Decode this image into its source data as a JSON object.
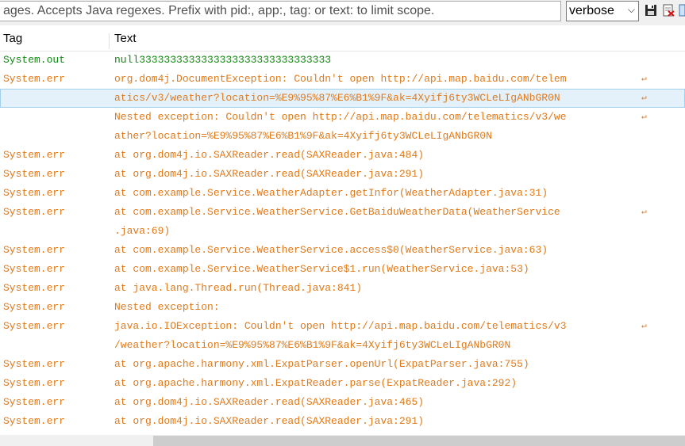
{
  "toolbar": {
    "filter_placeholder": "ages. Accepts Java regexes. Prefix with pid:, app:, tag: or text: to limit scope.",
    "level_value": "verbose",
    "icons": [
      "save-icon",
      "clear-log-icon",
      "scroll-lock-icon"
    ]
  },
  "columns": {
    "tag": "Tag",
    "text": "Text"
  },
  "colors": {
    "system_out": "#118811",
    "system_err": "#e07a1a",
    "selection": "#e4f1fb"
  },
  "rows": [
    {
      "tag": "System.out",
      "text": "null3333333333333333333333333333333",
      "wrap": false,
      "level": "out"
    },
    {
      "tag": "System.err",
      "text": "org.dom4j.DocumentException: Couldn't open http://api.map.baidu.com/telem",
      "wrap": true,
      "level": "err"
    },
    {
      "tag": "",
      "text": "atics/v3/weather?location=%E9%95%87%E6%B1%9F&ak=4Xyifj6ty3WCLeLIgANbGR0N",
      "wrap": true,
      "level": "err",
      "selected": true
    },
    {
      "tag": "",
      "text": "Nested exception: Couldn't open http://api.map.baidu.com/telematics/v3/we",
      "wrap": true,
      "level": "err"
    },
    {
      "tag": "",
      "text": "ather?location=%E9%95%87%E6%B1%9F&ak=4Xyifj6ty3WCLeLIgANbGR0N",
      "wrap": false,
      "level": "err"
    },
    {
      "tag": "System.err",
      "text": "at org.dom4j.io.SAXReader.read(SAXReader.java:484)",
      "wrap": false,
      "level": "err"
    },
    {
      "tag": "System.err",
      "text": "at org.dom4j.io.SAXReader.read(SAXReader.java:291)",
      "wrap": false,
      "level": "err"
    },
    {
      "tag": "System.err",
      "text": "at com.example.Service.WeatherAdapter.getInfor(WeatherAdapter.java:31)",
      "wrap": false,
      "level": "err"
    },
    {
      "tag": "System.err",
      "text": "at com.example.Service.WeatherService.GetBaiduWeatherData(WeatherService",
      "wrap": true,
      "level": "err"
    },
    {
      "tag": "",
      "text": ".java:69)",
      "wrap": false,
      "level": "err"
    },
    {
      "tag": "System.err",
      "text": "at com.example.Service.WeatherService.access$0(WeatherService.java:63)",
      "wrap": false,
      "level": "err"
    },
    {
      "tag": "System.err",
      "text": "at com.example.Service.WeatherService$1.run(WeatherService.java:53)",
      "wrap": false,
      "level": "err"
    },
    {
      "tag": "System.err",
      "text": "at java.lang.Thread.run(Thread.java:841)",
      "wrap": false,
      "level": "err"
    },
    {
      "tag": "System.err",
      "text": "Nested exception:",
      "wrap": false,
      "level": "err"
    },
    {
      "tag": "System.err",
      "text": "java.io.IOException: Couldn't open http://api.map.baidu.com/telematics/v3",
      "wrap": true,
      "level": "err"
    },
    {
      "tag": "",
      "text": "/weather?location=%E9%95%87%E6%B1%9F&ak=4Xyifj6ty3WCLeLIgANbGR0N",
      "wrap": false,
      "level": "err"
    },
    {
      "tag": "System.err",
      "text": "at org.apache.harmony.xml.ExpatParser.openUrl(ExpatParser.java:755)",
      "wrap": false,
      "level": "err"
    },
    {
      "tag": "System.err",
      "text": "at org.apache.harmony.xml.ExpatReader.parse(ExpatReader.java:292)",
      "wrap": false,
      "level": "err"
    },
    {
      "tag": "System.err",
      "text": "at org.dom4j.io.SAXReader.read(SAXReader.java:465)",
      "wrap": false,
      "level": "err"
    },
    {
      "tag": "System.err",
      "text": "at org.dom4j.io.SAXReader.read(SAXReader.java:291)",
      "wrap": false,
      "level": "err"
    }
  ]
}
